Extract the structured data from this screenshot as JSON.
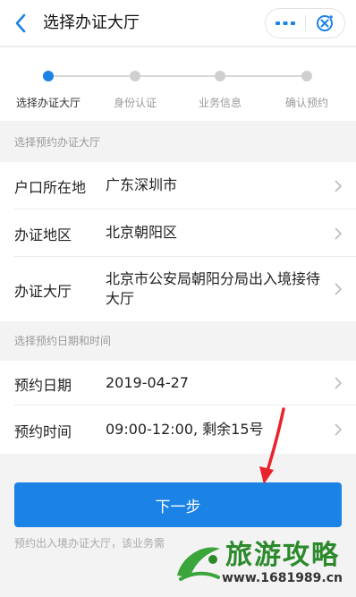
{
  "header": {
    "title": "选择办证大厅",
    "more_icon": "more-dots-icon",
    "close_icon": "target-close-icon"
  },
  "steps": [
    {
      "label": "选择办证大厅",
      "active": true
    },
    {
      "label": "身份认证",
      "active": false
    },
    {
      "label": "业务信息",
      "active": false
    },
    {
      "label": "确认预约",
      "active": false
    }
  ],
  "section_hall": {
    "title": "选择预约办证大厅"
  },
  "hall_rows": [
    {
      "label": "户口所在地",
      "value": "广东深圳市"
    },
    {
      "label": "办证地区",
      "value": "北京朝阳区"
    },
    {
      "label": "办证大厅",
      "value": "北京市公安局朝阳分局出入境接待大厅"
    }
  ],
  "section_time": {
    "title": "选择预约日期和时间"
  },
  "time_rows": [
    {
      "label": "预约日期",
      "value": "2019-04-27"
    },
    {
      "label": "预约时间",
      "value": "09:00-12:00, 剩余15号"
    }
  ],
  "next_button": {
    "label": "下一步"
  },
  "footnote": "预约出入境办证大厅，该业务需",
  "watermark": {
    "title": "旅游攻略",
    "url": "www.1681989.cn"
  },
  "colors": {
    "accent": "#1b82e6",
    "annotation": "#e8232b",
    "watermark_green": "#2c8a2c"
  }
}
